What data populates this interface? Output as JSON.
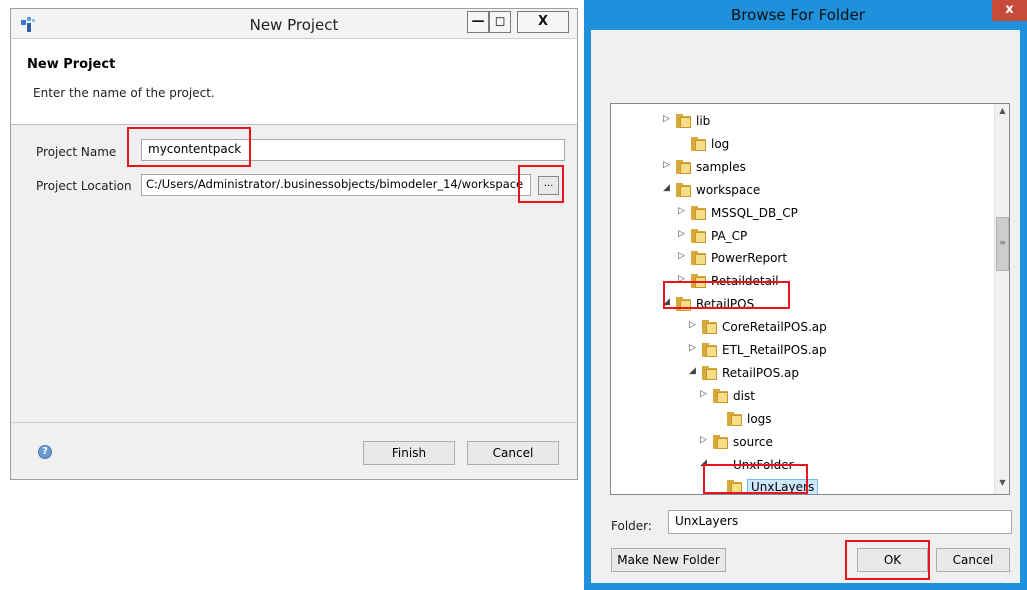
{
  "new_project": {
    "title": "New Project",
    "minimize_glyph": "—",
    "maximize_glyph": "◻",
    "close_glyph": "X",
    "heading": "New Project",
    "description": "Enter the name of the project.",
    "name_label": "Project Name",
    "name_value": "mycontentpack",
    "location_label": "Project Location",
    "location_value": "C:/Users/Administrator/.businessobjects/bimodeler_14/workspace",
    "browse_label": "...",
    "finish_label": "Finish",
    "cancel_label": "Cancel",
    "help_glyph": "?"
  },
  "browse_folder": {
    "title": "Browse For Folder",
    "close_glyph": "x",
    "tree": [
      {
        "label": "lib",
        "expander": "▷"
      },
      {
        "label": "log",
        "expander": ""
      },
      {
        "label": "samples",
        "expander": "▷"
      },
      {
        "label": "workspace",
        "expander": "◢"
      },
      {
        "label": "MSSQL_DB_CP",
        "expander": "▷"
      },
      {
        "label": "PA_CP",
        "expander": "▷"
      },
      {
        "label": "PowerReport",
        "expander": "▷"
      },
      {
        "label": "Retaildetail",
        "expander": "▷"
      },
      {
        "label": "RetailPOS",
        "expander": "◢"
      },
      {
        "label": "CoreRetailPOS.ap",
        "expander": "▷"
      },
      {
        "label": "ETL_RetailPOS.ap",
        "expander": "▷"
      },
      {
        "label": "RetailPOS.ap",
        "expander": "◢"
      },
      {
        "label": "dist",
        "expander": "▷"
      },
      {
        "label": "logs",
        "expander": ""
      },
      {
        "label": "source",
        "expander": "▷"
      },
      {
        "label": "UnxFolder",
        "expander": "◢"
      },
      {
        "label": "UnxLayers",
        "expander": ""
      }
    ],
    "folder_label": "Folder:",
    "folder_value": "UnxLayers",
    "new_folder_label": "Make New Folder",
    "ok_label": "OK",
    "cancel_label": "Cancel",
    "scroll_up_glyph": "▲",
    "scroll_down_glyph": "▼",
    "scroll_thumb_glyph": "≡"
  },
  "colors": {
    "highlight": "#e8141e",
    "dialog_frame": "#1e90dc",
    "folder": "#f6dd88",
    "selection": "#cde8ff"
  }
}
